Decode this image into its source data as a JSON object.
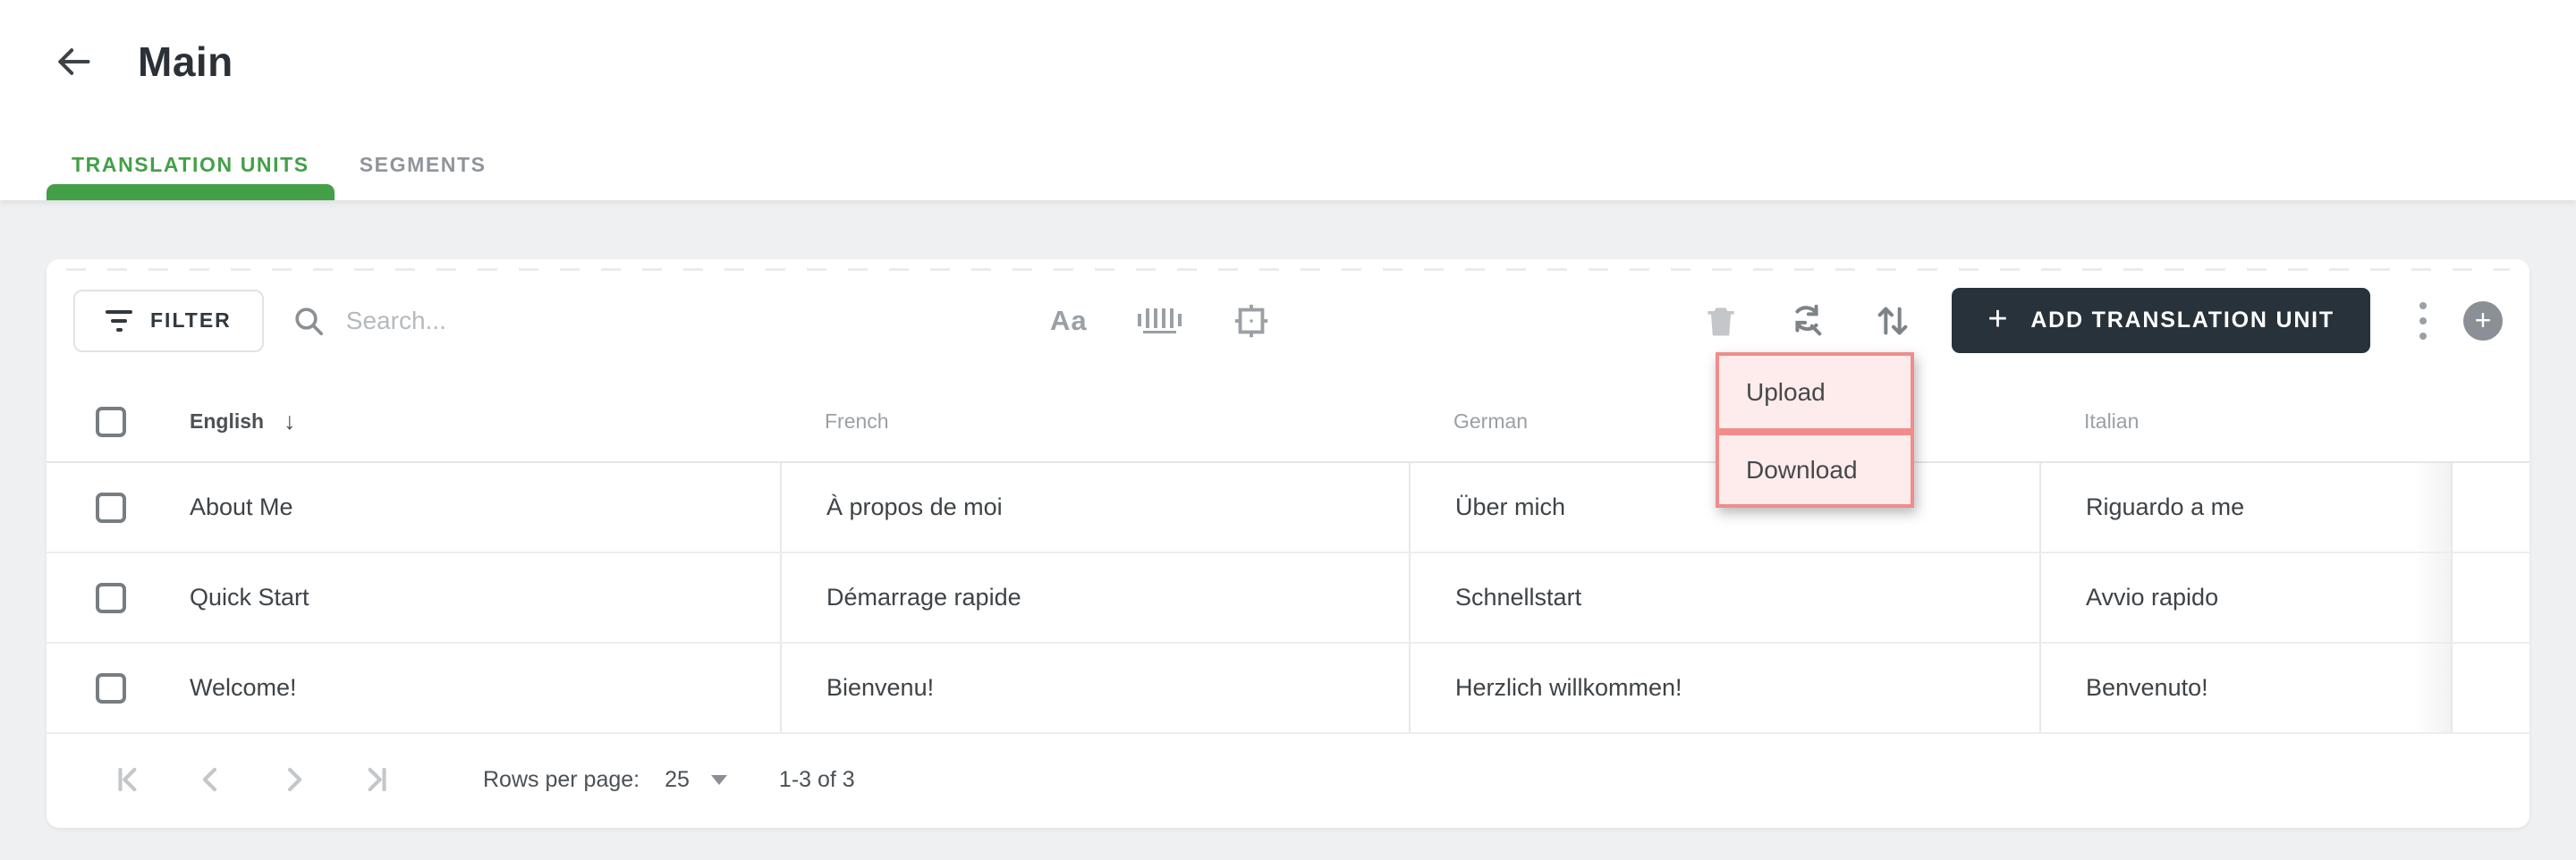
{
  "header": {
    "title": "Main",
    "back_icon": "arrow-left-icon"
  },
  "tabs": [
    {
      "label": "TRANSLATION UNITS",
      "active": true
    },
    {
      "label": "SEGMENTS",
      "active": false
    }
  ],
  "toolbar": {
    "filter_label": "FILTER",
    "search_placeholder": "Search...",
    "match_case_label": "Aa",
    "add_button_plus": "+",
    "add_button_label": "ADD TRANSLATION UNIT",
    "icons": [
      "filter-icon",
      "search-icon",
      "match-case-icon",
      "whole-word-icon",
      "exact-match-frame-icon",
      "trash-icon",
      "find-replace-icon",
      "import-export-icon",
      "kebab-menu-icon",
      "plus-circle-icon"
    ]
  },
  "menu": {
    "items": [
      {
        "label": "Upload"
      },
      {
        "label": "Download"
      }
    ],
    "highlight_border_color": "#f18c8c",
    "highlight_background_color": "#fdeceb"
  },
  "table": {
    "columns": [
      {
        "label": "English",
        "sorted": "desc"
      },
      {
        "label": "French",
        "sorted": ""
      },
      {
        "label": "German",
        "sorted": ""
      },
      {
        "label": "Italian",
        "sorted": ""
      }
    ],
    "sort_arrow": "↓",
    "rows": [
      [
        "About Me",
        "À propos de moi",
        "Über mich",
        "Riguardo a me"
      ],
      [
        "Quick Start",
        "Démarrage rapide",
        "Schnellstart",
        "Avvio rapido"
      ],
      [
        "Welcome!",
        "Bienvenu!",
        "Herzlich willkommen!",
        "Benvenuto!"
      ]
    ]
  },
  "pagination": {
    "rows_per_page_label": "Rows per page:",
    "rows_per_page_value": "25",
    "range_label": "1-3 of 3"
  },
  "colors": {
    "accent_green": "#43a047",
    "add_button_bg": "#27323a",
    "page_bg": "#eef0f2",
    "highlight_border": "#f18c8c",
    "highlight_bg": "#fdeceb",
    "disabled_icon": "#c3c7ca",
    "icon_gray": "#9aa0a6"
  }
}
